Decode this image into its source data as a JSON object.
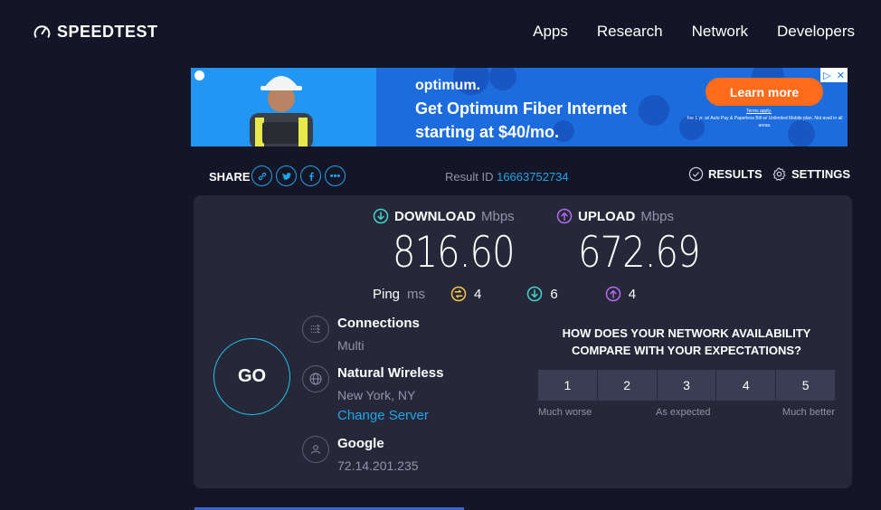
{
  "header": {
    "logo_text": "SPEEDTEST",
    "nav": [
      "Apps",
      "Research",
      "Network",
      "Developers"
    ]
  },
  "ad": {
    "brand": "optimum.",
    "headline_1": "Get Optimum Fiber Internet",
    "headline_2": "starting at $40/mo.",
    "cta": "Learn more",
    "terms": "Terms apply.",
    "fine_print": "For 1 yr. w/ Auto Pay & Paperless Bill w/ Unlimited Mobile plan. Not avail in all areas."
  },
  "toolbar": {
    "share_label": "SHARE",
    "result_id_label": "Result ID",
    "result_id": "16663752734",
    "results_label": "RESULTS",
    "settings_label": "SETTINGS"
  },
  "metrics": {
    "download": {
      "label": "DOWNLOAD",
      "unit": "Mbps",
      "value": "816.60"
    },
    "upload": {
      "label": "UPLOAD",
      "unit": "Mbps",
      "value": "672.69"
    }
  },
  "ping": {
    "label": "Ping",
    "unit": "ms",
    "idle": "4",
    "download": "6",
    "upload": "4"
  },
  "go_label": "GO",
  "connection": {
    "connections_title": "Connections",
    "connections_value": "Multi",
    "server_title": "Natural Wireless",
    "server_location": "New York, NY",
    "change_server": "Change Server",
    "isp_title": "Google",
    "isp_ip": "72.14.201.235"
  },
  "survey": {
    "question_1": "HOW DOES YOUR NETWORK AVAILABILITY",
    "question_2": "COMPARE WITH YOUR EXPECTATIONS?",
    "options": [
      "1",
      "2",
      "3",
      "4",
      "5"
    ],
    "label_low": "Much worse",
    "label_mid": "As expected",
    "label_high": "Much better"
  },
  "colors": {
    "background": "#141526",
    "panel": "#26283a",
    "accent_cyan": "#1ec6e6",
    "link_blue": "#1ea5e6",
    "download_icon": "#3fd7c9",
    "upload_icon": "#b36bf0",
    "idle_icon": "#f5c842"
  }
}
